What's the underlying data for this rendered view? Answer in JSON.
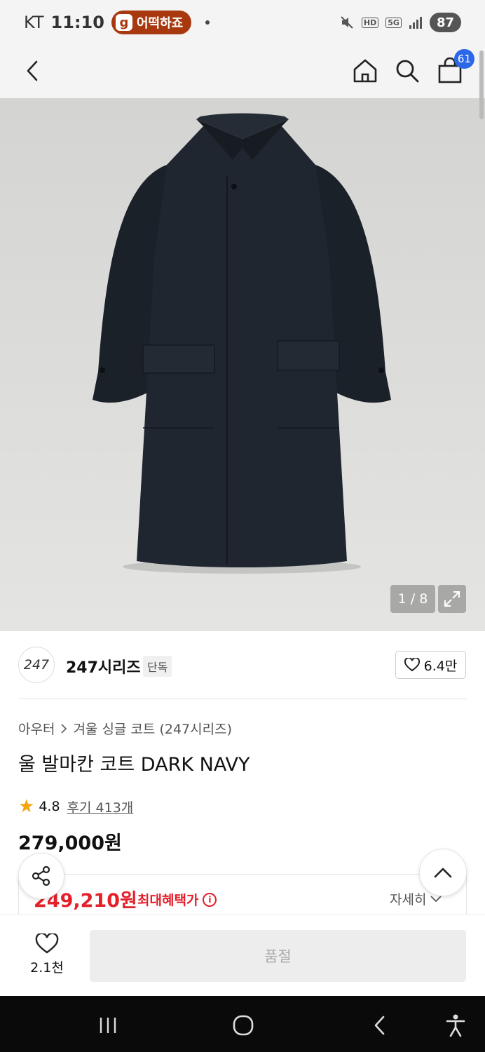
{
  "status_bar": {
    "carrier": "KT",
    "time": "11:10",
    "notif_pill": "어떡하죠",
    "notif_pill_icon": "g-app-icon",
    "hd": "HD",
    "net": "5G",
    "battery": "87"
  },
  "header": {
    "back_icon": "chevron-left-icon",
    "home_icon": "home-icon",
    "search_icon": "search-icon",
    "cart_icon": "bag-icon",
    "cart_count": "61"
  },
  "gallery": {
    "counter": "1 / 8",
    "expand_icon": "expand-icon"
  },
  "brand": {
    "logo_text": "247",
    "name": "247시리즈",
    "tag": "단독",
    "likes": "6.4만"
  },
  "product": {
    "breadcrumb": [
      "아우터",
      "겨울 싱글 코트 (247시리즈)"
    ],
    "title": "울 발마칸 코트 DARK NAVY",
    "rating": "4.8",
    "reviews": "후기 413개",
    "price": "279,000원",
    "sale_price": "249,210원",
    "sale_label": "최대혜택가",
    "detail_label": "자세히"
  },
  "action_bar": {
    "wish_count": "2.1천",
    "buy_label": "품절"
  },
  "colors": {
    "accent_red": "#e4202a",
    "badge_blue": "#2c67e8",
    "star": "#f3a70f",
    "pill": "#a8390f"
  }
}
